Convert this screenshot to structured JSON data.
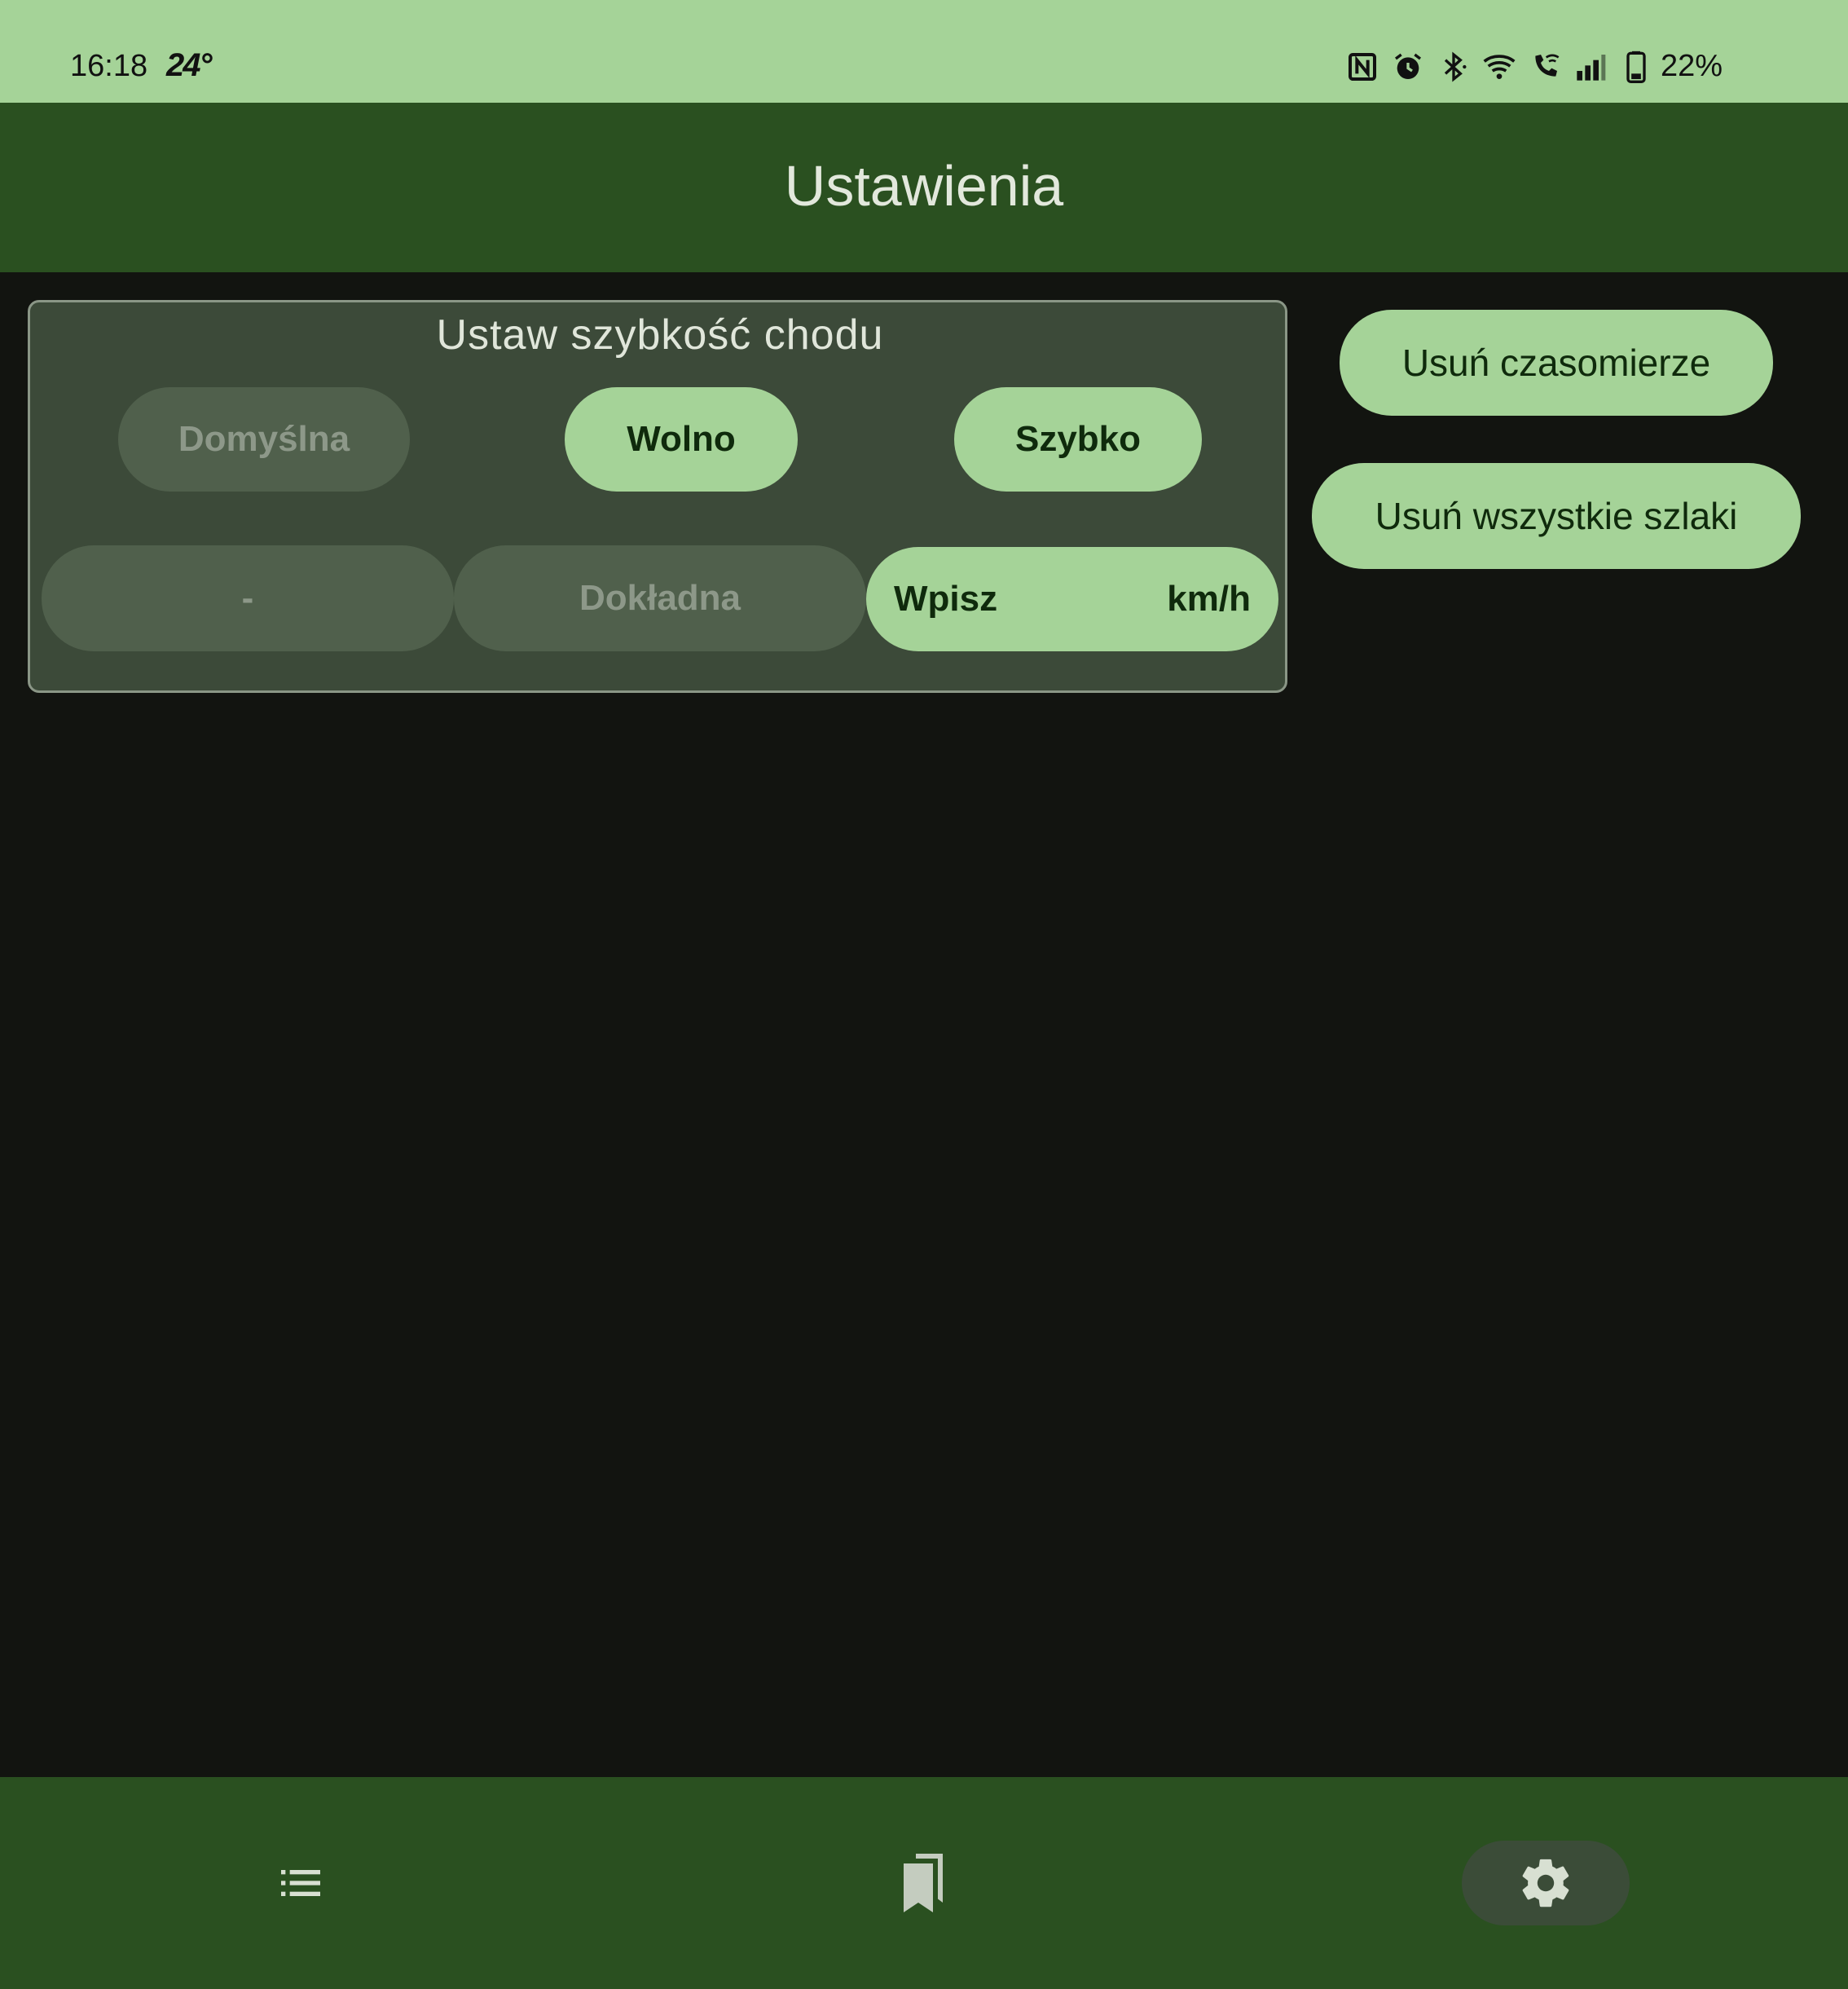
{
  "status_bar": {
    "time": "16:18",
    "temperature": "24°",
    "battery": "22%",
    "icons": [
      "nfc-icon",
      "alarm-icon",
      "bluetooth-icon",
      "wifi-icon",
      "wifi-call-icon",
      "signal-icon",
      "battery-icon"
    ]
  },
  "app_bar": {
    "title": "Ustawienia"
  },
  "speed_settings": {
    "title": "Ustaw szybkość chodu",
    "presets": [
      {
        "label": "Domyślna",
        "state": "disabled"
      },
      {
        "label": "Wolno",
        "state": "active"
      },
      {
        "label": "Szybko",
        "state": "active"
      }
    ],
    "modes": [
      {
        "label": "-",
        "state": "disabled"
      },
      {
        "label": "Dokładna",
        "state": "disabled"
      }
    ],
    "input": {
      "label": "Wpisz",
      "unit": "km/h"
    }
  },
  "actions": {
    "delete_timers": "Usuń czasomierze",
    "delete_trails": "Usuń wszystkie szlaki"
  },
  "bottom_nav": {
    "items": [
      {
        "icon": "list-icon",
        "selected": false
      },
      {
        "icon": "bookmarks-icon",
        "selected": false
      },
      {
        "icon": "settings-gear-icon",
        "selected": true
      }
    ]
  },
  "colors": {
    "status_bar_bg": "#a5d398",
    "app_bar_bg": "#2a5020",
    "background": "#121410",
    "accent_button": "#a5d398",
    "disabled_button": "#50604c",
    "card_bg": "#3c4a39"
  }
}
